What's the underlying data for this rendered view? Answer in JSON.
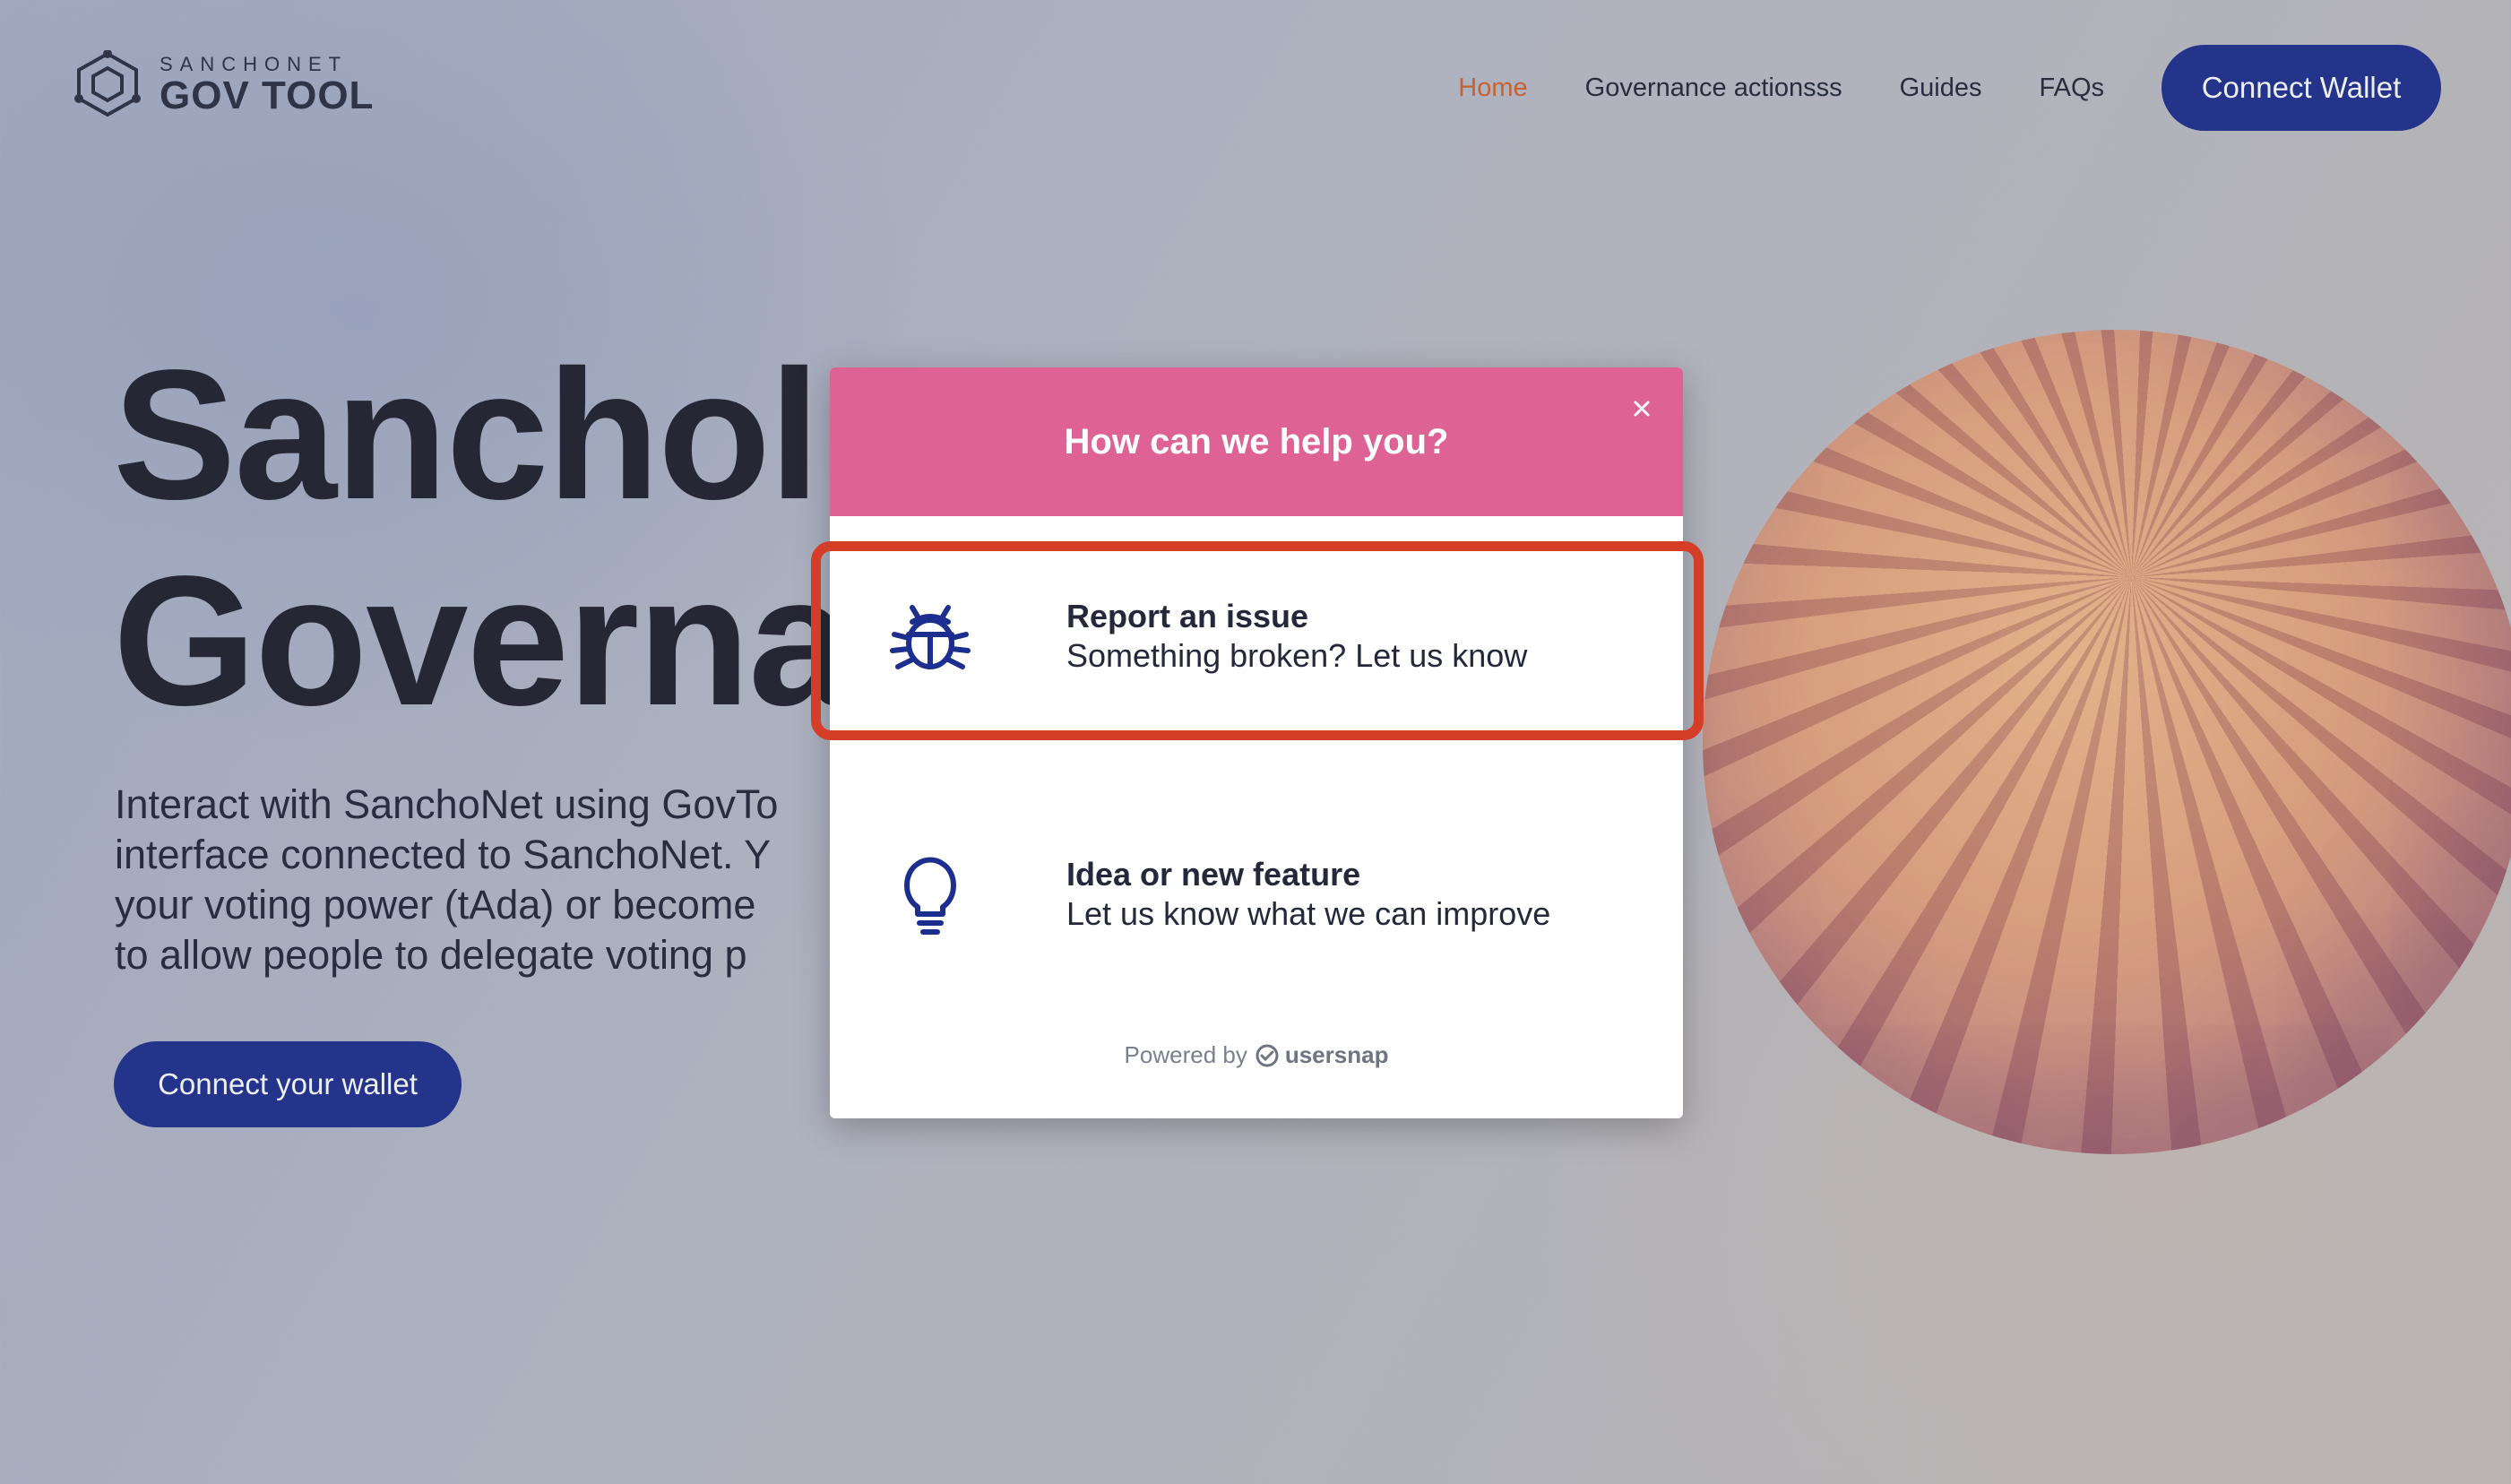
{
  "header": {
    "logo_small": "SANCHONET",
    "logo_big": "GOV TOOL",
    "nav": [
      {
        "label": "Home",
        "active": true
      },
      {
        "label": "Governance actionsss",
        "active": false
      },
      {
        "label": "Guides",
        "active": false
      },
      {
        "label": "FAQs",
        "active": false
      }
    ],
    "connect_label": "Connect Wallet"
  },
  "hero": {
    "title_line1": "Sanchol",
    "title_line2": "Governa",
    "text_lines": [
      "Interact with SanchoNet using GovTo",
      "interface connected to SanchoNet. Y",
      "your voting power (tAda) or become",
      "to allow people to delegate voting p"
    ],
    "button_label": "Connect your wallet"
  },
  "modal": {
    "title": "How can we help you?",
    "options": [
      {
        "title": "Report an issue",
        "subtitle": "Something broken? Let us know",
        "icon": "bug-icon"
      },
      {
        "title": "Idea or new feature",
        "subtitle": "Let us know what we can improve",
        "icon": "lightbulb-icon"
      }
    ],
    "powered_by": "Powered by",
    "powered_brand": "usersnap"
  },
  "colors": {
    "accent": "#de6394",
    "primary": "#1d2f8e",
    "nav_active": "#d2632c",
    "highlight": "#d43d28"
  }
}
